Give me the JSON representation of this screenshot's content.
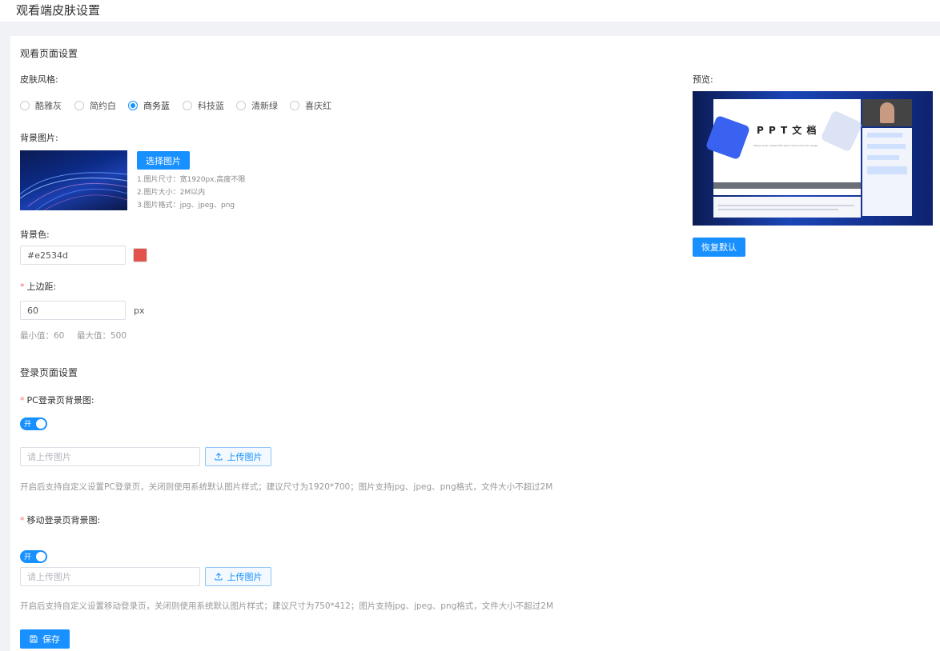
{
  "page": {
    "title": "观看端皮肤设置"
  },
  "watch_section": {
    "title": "观看页面设置",
    "skin_label": "皮肤风格:",
    "skins": [
      "酷雅灰",
      "简约白",
      "商务蓝",
      "科技蓝",
      "清新绿",
      "喜庆红"
    ],
    "selected_skin": "商务蓝",
    "bg_image_label": "背景图片:",
    "choose_image_button": "选择图片",
    "image_hints": [
      "1.图片尺寸：宽1920px,高度不限",
      "2.图片大小：2M以内",
      "3.图片格式：jpg、jpeg、png"
    ],
    "bg_color_label": "背景色:",
    "bg_color_value": "#e2534d",
    "bg_color_swatch": "#e2534d",
    "top_margin_label": "上边距:",
    "top_margin_value": "60",
    "top_margin_unit": "px",
    "min_text": "最小值：60",
    "max_text": "最大值：500"
  },
  "preview": {
    "label": "预览:",
    "slide_title": "P P T 文 档",
    "slide_subtitle": "Please enter related PPT basic introduction for design",
    "restore_button": "恢复默认"
  },
  "login_section": {
    "title": "登录页面设置",
    "pc_label": "PC登录页背景图:",
    "pc_toggle_text": "开",
    "pc_placeholder": "请上传图片",
    "pc_upload_button": "上传图片",
    "pc_desc": "开启后支持自定义设置PC登录页，关闭则使用系统默认图片样式；建议尺寸为1920*700；图片支持jpg、jpeg、png格式，文件大小不超过2M",
    "mobile_label": "移动登录页背景图:",
    "mobile_toggle_text": "开",
    "mobile_placeholder": "请上传图片",
    "mobile_upload_button": "上传图片",
    "mobile_desc": "开启后支持自定义设置移动登录页，关闭则使用系统默认图片样式；建议尺寸为750*412；图片支持jpg、jpeg、png格式，文件大小不超过2M"
  },
  "save_button": "保存",
  "colors": {
    "accent": "#1890ff",
    "required": "#f56c6c"
  }
}
